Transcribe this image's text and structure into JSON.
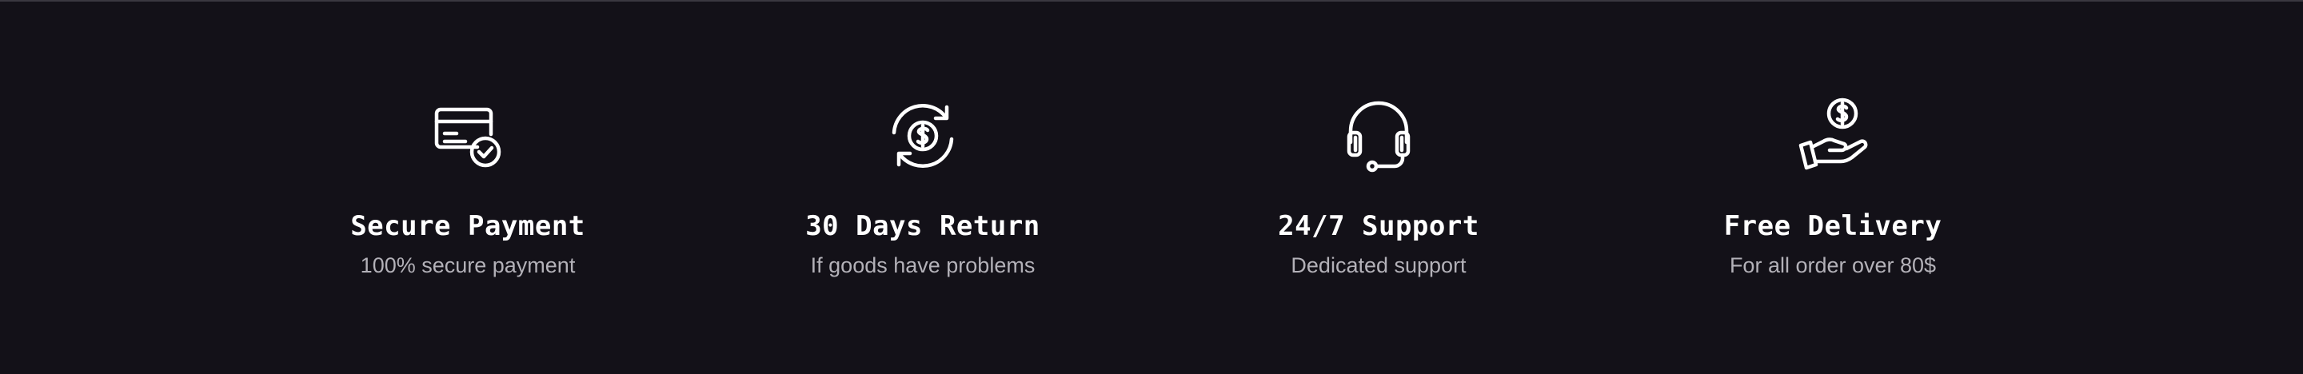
{
  "features": [
    {
      "icon": "credit-card-check-icon",
      "title": "Secure Payment",
      "subtitle": "100% secure payment"
    },
    {
      "icon": "dollar-refresh-icon",
      "title": "30 Days Return",
      "subtitle": "If goods have problems"
    },
    {
      "icon": "headset-icon",
      "title": "24/7 Support",
      "subtitle": "Dedicated support"
    },
    {
      "icon": "hand-coin-icon",
      "title": "Free Delivery",
      "subtitle": "For all order over 80$"
    }
  ],
  "colors": {
    "background": "#131118",
    "title": "#FFFFFF",
    "subtitle": "#B3B1B8",
    "icon": "#FFFFFF"
  }
}
